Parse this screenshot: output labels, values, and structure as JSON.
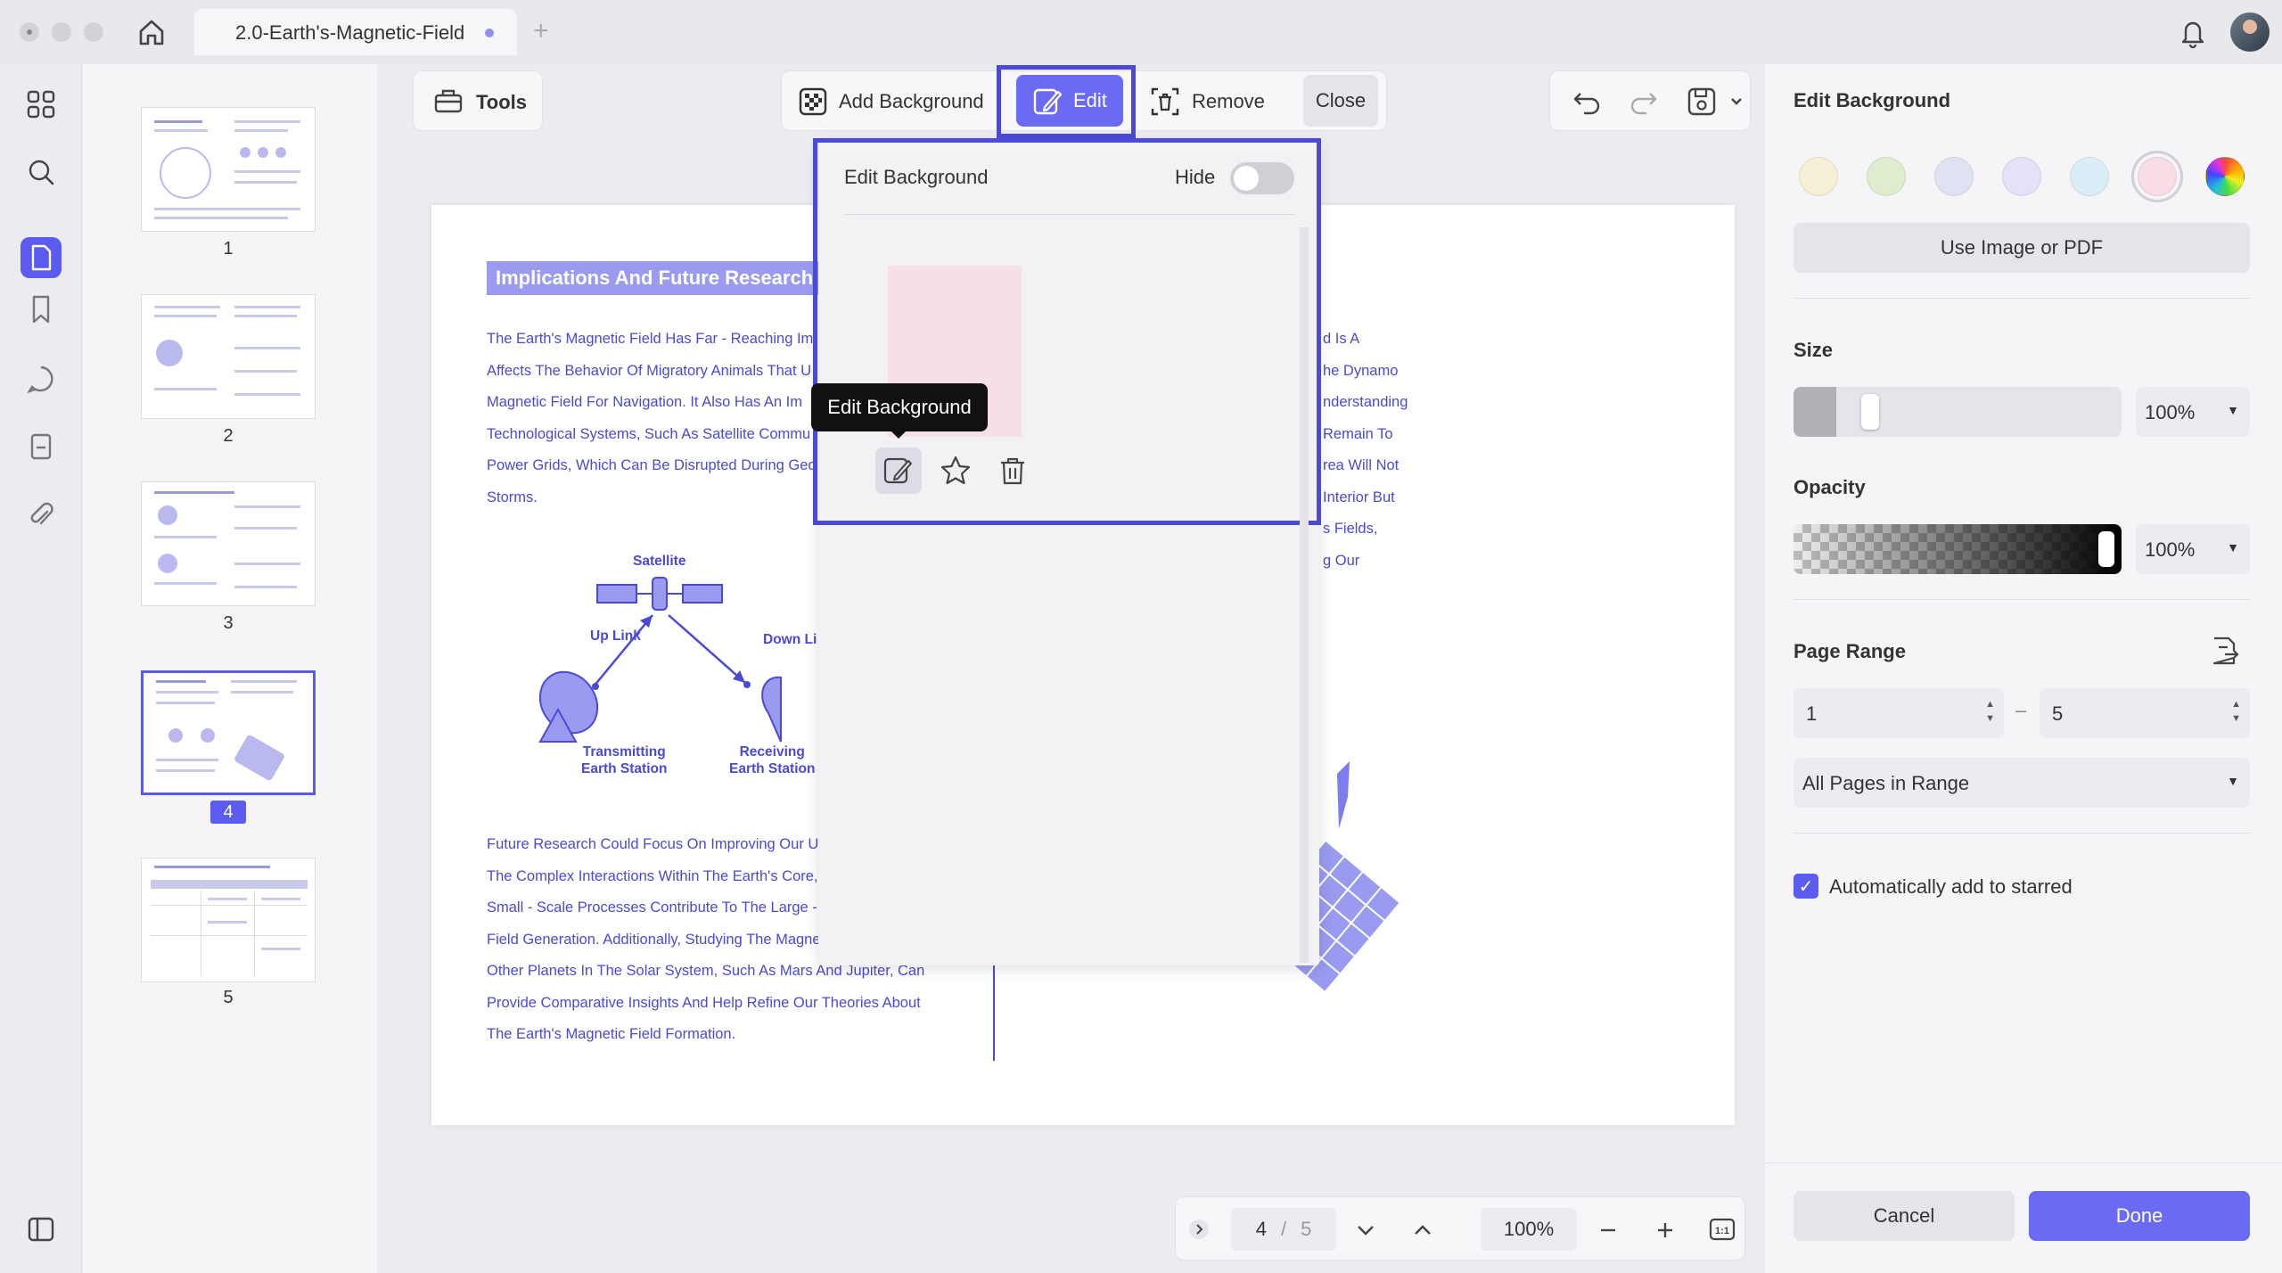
{
  "titlebar": {
    "tab_title": "2.0-Earth's-Magnetic-Field"
  },
  "thumbnails": {
    "pages": [
      "1",
      "2",
      "3",
      "4",
      "5"
    ],
    "current": "4"
  },
  "toolbar": {
    "tools_label": "Tools",
    "add_background_label": "Add Background",
    "edit_label": "Edit",
    "remove_label": "Remove",
    "close_label": "Close"
  },
  "document": {
    "heading": "Implications And Future Research",
    "para1": "The Earth's Magnetic Field Has Far - Reaching Im\nAffects The Behavior Of Migratory Animals That U\nMagnetic Field For Navigation. It Also Has An Im\nTechnological Systems, Such As Satellite Commu\nPower Grids, Which Can Be Disrupted During Geo\nStorms.",
    "right_para": "d Is A\nhe Dynamo\nnderstanding\nRemain To\nrea Will Not\nInterior But\ns Fields,\ng Our",
    "para2": "Future Research Could Focus On Improving Our U\nThe Complex Interactions Within The Earth's Core,\nSmall - Scale Processes Contribute To The Large -\nField Generation. Additionally, Studying The Magne\nOther Planets In The Solar System, Such As Mars And Jupiter, Can\nProvide Comparative Insights And Help Refine Our Theories About\nThe Earth's Magnetic Field Formation.",
    "diagram": {
      "satellite": "Satellite",
      "uplink": "Up Link",
      "downlink": "Down Li",
      "transmitting": "Transmitting\nEarth Station",
      "receiving": "Receiving\nEarth Station"
    }
  },
  "popover": {
    "title": "Edit Background",
    "hide_label": "Hide",
    "hide_on": false,
    "tooltip": "Edit Background"
  },
  "pagenav": {
    "current": "4",
    "separator": "/",
    "total": "5",
    "zoom": "100%"
  },
  "right_panel": {
    "title": "Edit Background",
    "swatches": [
      "#f5efd6",
      "#dfeccd",
      "#dfe2f3",
      "#e6e0f8",
      "#dbeef8",
      "#f8dde4"
    ],
    "selected_swatch": 5,
    "use_image_label": "Use Image or PDF",
    "size_label": "Size",
    "size_value": "100%",
    "opacity_label": "Opacity",
    "opacity_value": "100%",
    "page_range_label": "Page Range",
    "range_from": "1",
    "range_dash": "–",
    "range_to": "5",
    "pages_option": "All Pages in Range",
    "auto_star_label": "Automatically add to starred",
    "auto_star_checked": true,
    "cancel_label": "Cancel",
    "done_label": "Done"
  },
  "colors": {
    "accent": "#5b5bf0",
    "highlight": "#4a4ad6"
  }
}
